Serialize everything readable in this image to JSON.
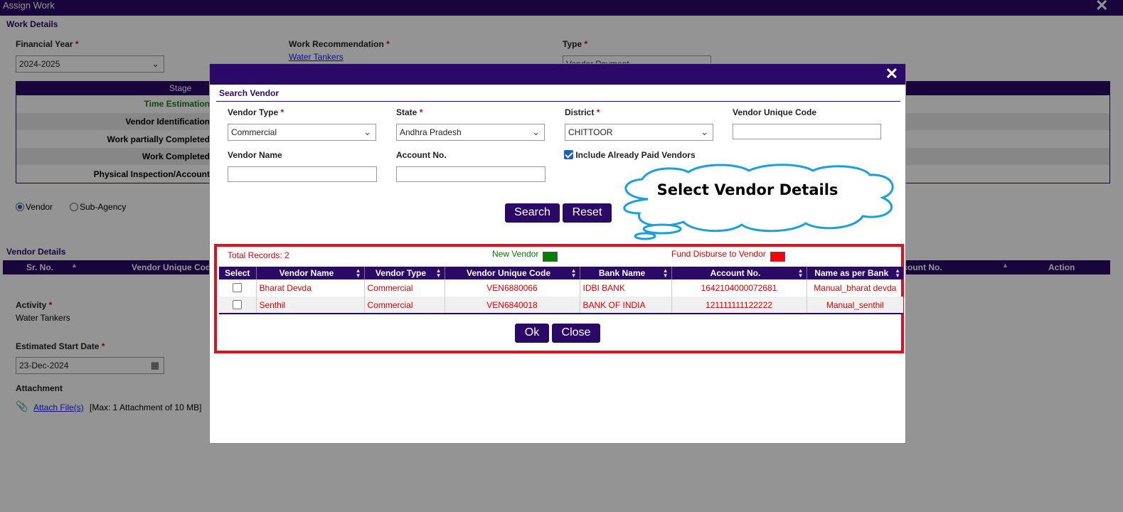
{
  "window": {
    "title": "Assign Work",
    "close_glyph": "✕"
  },
  "work_details": {
    "section_title": "Work Details",
    "financial_year": {
      "label": "Financial Year",
      "value": "2024-2025"
    },
    "work_recommendation": {
      "label": "Work Recommendation",
      "value": "Water Tankers"
    },
    "type": {
      "label": "Type",
      "value": "Vendor Payment"
    },
    "stage_table": {
      "header": "Stage",
      "rows": [
        "Time Estimation",
        "Vendor Identification",
        "Work partially Completed",
        "Work Completed",
        "Physical Inspection/Account"
      ]
    },
    "assignee_options": [
      "Vendor",
      "Sub-Agency"
    ],
    "assignee_selected": "Vendor"
  },
  "vendor_details": {
    "section_title": "Vendor Details",
    "columns": [
      "Sr. No.",
      "Vendor Unique Code",
      "Account No.",
      "Action"
    ]
  },
  "activity": {
    "label": "Activity",
    "value": "Water Tankers"
  },
  "start_date": {
    "label": "Estimated Start Date",
    "value": "23-Dec-2024"
  },
  "attachment": {
    "label": "Attachment",
    "link": "Attach File(s)",
    "note": "[Max: 1 Attachment of 10 MB]"
  },
  "modal": {
    "close_glyph": "✕",
    "title": "Search Vendor",
    "fields": {
      "vendor_type": {
        "label": "Vendor Type",
        "value": "Commercial"
      },
      "state": {
        "label": "State",
        "value": "Andhra Pradesh"
      },
      "district": {
        "label": "District",
        "value": "CHITTOOR"
      },
      "vendor_unique_code": {
        "label": "Vendor Unique Code",
        "value": ""
      },
      "vendor_name": {
        "label": "Vendor Name",
        "value": ""
      },
      "account_no": {
        "label": "Account No.",
        "value": ""
      },
      "include_paid": {
        "label": "Include Already Paid Vendors",
        "checked": true
      }
    },
    "buttons": {
      "search": "Search",
      "reset": "Reset",
      "ok": "Ok",
      "close": "Close"
    },
    "callout": "Select Vendor Details",
    "results": {
      "total_records": "Total Records: 2",
      "legend_new": "New Vendor",
      "legend_new_color": "#008000",
      "legend_fund": "Fund Disburse to Vendor",
      "legend_fund_color": "#ff0000",
      "columns": [
        "Select",
        "Vendor Name",
        "Vendor Type",
        "Vendor Unique Code",
        "Bank Name",
        "Account No.",
        "Name as per Bank"
      ],
      "rows": [
        {
          "name": "Bharat Devda",
          "type": "Commercial",
          "code": "VEN6880066",
          "bank": "IDBI BANK",
          "account": "1642104000072681",
          "bank_name": "Manual_bharat devda"
        },
        {
          "name": "Senthil",
          "type": "Commercial",
          "code": "VEN6840018",
          "bank": "BANK OF INDIA",
          "account": "121111111122222",
          "bank_name": "Manual_senthil"
        }
      ]
    }
  },
  "colors": {
    "brand": "#2a0a66",
    "highlight": "#e01020",
    "callout": "#1aa0e0"
  }
}
